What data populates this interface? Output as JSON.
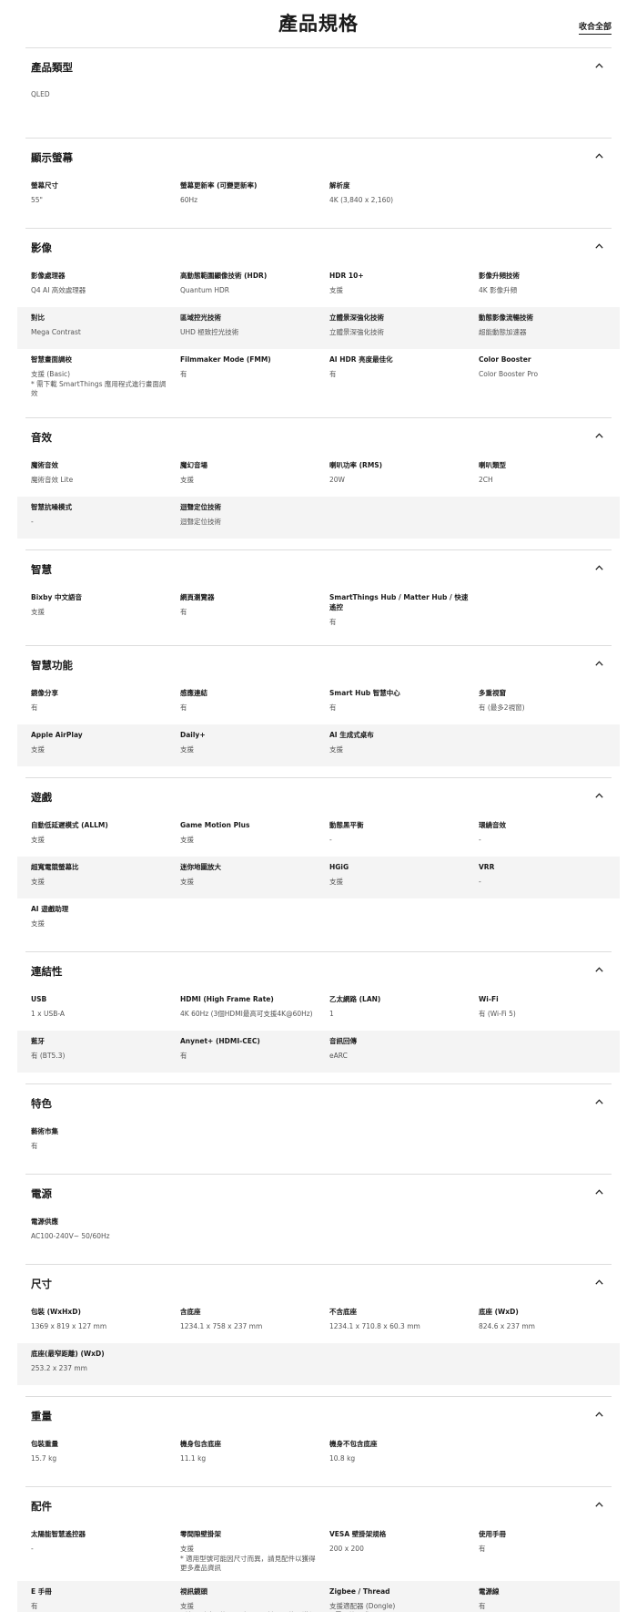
{
  "header": {
    "title": "產品規格",
    "collapse_all": "收合全部"
  },
  "sections": [
    {
      "title": "產品類型",
      "rows": [
        [
          {
            "label": "",
            "value": "QLED"
          }
        ]
      ]
    },
    {
      "title": "顯示螢幕",
      "rows": [
        [
          {
            "label": "螢幕尺寸",
            "value": "55\""
          },
          {
            "label": "螢幕更新率 (可變更新率)",
            "value": "60Hz"
          },
          {
            "label": "解析度",
            "value": "4K (3,840 x 2,160)"
          }
        ]
      ]
    },
    {
      "title": "影像",
      "rows": [
        [
          {
            "label": "影像處理器",
            "value": "Q4 AI 高效處理器"
          },
          {
            "label": "高動態範圍顯像技術 (HDR)",
            "value": "Quantum HDR"
          },
          {
            "label": "HDR 10+",
            "value": "支援"
          },
          {
            "label": "影像升頻技術",
            "value": "4K 影像升頻"
          }
        ],
        [
          {
            "label": "對比",
            "value": "Mega Contrast"
          },
          {
            "label": "區域控光技術",
            "value": "UHD 極致控光技術"
          },
          {
            "label": "立體景深強化技術",
            "value": "立體景深強化技術"
          },
          {
            "label": "動態影像流暢技術",
            "value": "超能動態加速器"
          }
        ],
        [
          {
            "label": "智慧畫面調校",
            "value": "支援 (Basic)\n* 需下載 SmartThings 應用程式進行畫面調效"
          },
          {
            "label": "Filmmaker Mode (FMM)",
            "value": "有"
          },
          {
            "label": "AI HDR 亮度最佳化",
            "value": "有"
          },
          {
            "label": "Color Booster",
            "value": "Color Booster Pro"
          }
        ]
      ]
    },
    {
      "title": "音效",
      "rows": [
        [
          {
            "label": "魔術音效",
            "value": "魔術音效 Lite"
          },
          {
            "label": "魔幻音場",
            "value": "支援"
          },
          {
            "label": "喇叭功率 (RMS)",
            "value": "20W"
          },
          {
            "label": "喇叭類型",
            "value": "2CH"
          }
        ],
        [
          {
            "label": "智慧抗噪模式",
            "value": "-"
          },
          {
            "label": "迴聲定位技術",
            "value": "迴聲定位技術"
          }
        ]
      ]
    },
    {
      "title": "智慧",
      "rows": [
        [
          {
            "label": "Bixby 中文語音",
            "value": "支援"
          },
          {
            "label": "網頁瀏覽器",
            "value": "有"
          },
          {
            "label": "SmartThings Hub / Matter Hub / 快速遙控",
            "value": "有"
          }
        ]
      ]
    },
    {
      "title": "智慧功能",
      "rows": [
        [
          {
            "label": "鏡像分享",
            "value": "有"
          },
          {
            "label": "感應連結",
            "value": "有"
          },
          {
            "label": "Smart Hub 智慧中心",
            "value": "有"
          },
          {
            "label": "多重視窗",
            "value": "有 (最多2視窗)"
          }
        ],
        [
          {
            "label": "Apple AirPlay",
            "value": "支援"
          },
          {
            "label": "Daily+",
            "value": "支援"
          },
          {
            "label": "AI 生成式桌布",
            "value": "支援"
          }
        ]
      ]
    },
    {
      "title": "遊戲",
      "rows": [
        [
          {
            "label": "自動低延遲模式 (ALLM)",
            "value": "支援"
          },
          {
            "label": "Game Motion Plus",
            "value": "支援"
          },
          {
            "label": "動態黑平衡",
            "value": "-"
          },
          {
            "label": "環繞音效",
            "value": "-"
          }
        ],
        [
          {
            "label": "超寬電競螢幕比",
            "value": "支援"
          },
          {
            "label": "迷你地圖放大",
            "value": "支援"
          },
          {
            "label": "HGiG",
            "value": "支援"
          },
          {
            "label": "VRR",
            "value": "-"
          }
        ],
        [
          {
            "label": "AI 遊戲助理",
            "value": "支援"
          }
        ]
      ]
    },
    {
      "title": "連結性",
      "rows": [
        [
          {
            "label": "USB",
            "value": "1 x USB-A"
          },
          {
            "label": "HDMI (High Frame Rate)",
            "value": "4K 60Hz (3個HDMI最高可支援4K@60Hz)"
          },
          {
            "label": "乙太網路 (LAN)",
            "value": "1"
          },
          {
            "label": "Wi-Fi",
            "value": "有 (Wi-Fi 5)"
          }
        ],
        [
          {
            "label": "藍牙",
            "value": "有 (BT5.3)"
          },
          {
            "label": "Anynet+ (HDMI-CEC)",
            "value": "有"
          },
          {
            "label": "音訊回傳",
            "value": "eARC"
          }
        ]
      ]
    },
    {
      "title": "特色",
      "rows": [
        [
          {
            "label": "藝術市集",
            "value": "有"
          }
        ]
      ]
    },
    {
      "title": "電源",
      "rows": [
        [
          {
            "label": "電源供應",
            "value": "AC100-240V~ 50/60Hz"
          }
        ]
      ]
    },
    {
      "title": "尺寸",
      "rows": [
        [
          {
            "label": "包裝 (WxHxD)",
            "value": "1369 x 819 x 127 mm"
          },
          {
            "label": "含底座",
            "value": "1234.1 x 758 x 237 mm"
          },
          {
            "label": "不含底座",
            "value": "1234.1 x 710.8 x 60.3 mm"
          },
          {
            "label": "底座 (WxD)",
            "value": "824.6 x 237 mm"
          }
        ],
        [
          {
            "label": "底座(最窄距離) (WxD)",
            "value": "253.2 x 237 mm"
          }
        ]
      ]
    },
    {
      "title": "重量",
      "rows": [
        [
          {
            "label": "包裝重量",
            "value": "15.7 kg"
          },
          {
            "label": "機身包含底座",
            "value": "11.1 kg"
          },
          {
            "label": "機身不包含底座",
            "value": "10.8 kg"
          }
        ]
      ]
    },
    {
      "title": "配件",
      "rows": [
        [
          {
            "label": "太陽能智慧遙控器",
            "value": "-"
          },
          {
            "label": "零間隙壁掛架",
            "value": "支援\n* 適用型號可能因尺寸而異，請見配件以獲得更多產品資訊"
          },
          {
            "label": "VESA 壁掛架規格",
            "value": "200 x 200"
          },
          {
            "label": "使用手冊",
            "value": "有"
          }
        ],
        [
          {
            "label": "E 手冊",
            "value": "有"
          },
          {
            "label": "視訊鏡頭",
            "value": "支援\n* 適用型號可能因尺寸而異，請見配件以獲得更多產品資訊"
          },
          {
            "label": "Zigbee / Thread",
            "value": "支援適配器 (Dongle)\n* 需另外選購"
          },
          {
            "label": "電源線",
            "value": "有"
          }
        ]
      ]
    }
  ]
}
